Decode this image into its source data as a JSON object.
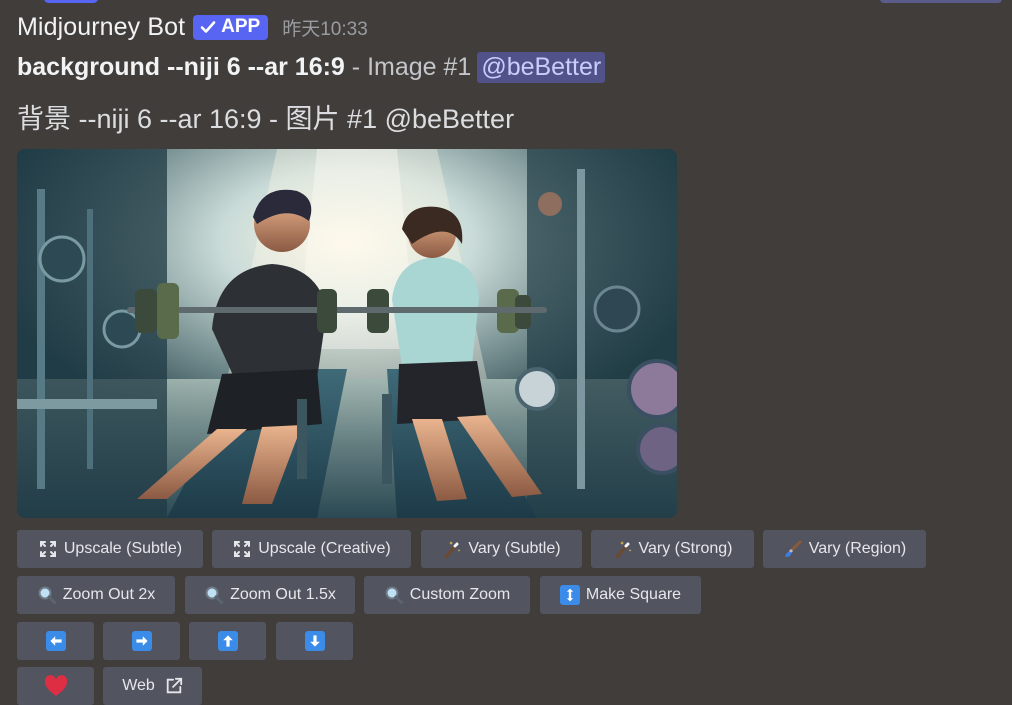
{
  "message": {
    "username": "Midjourney Bot",
    "badge": "APP",
    "timestamp": "昨天10:33",
    "prompt_bold": "background --niji 6 --ar 16:9",
    "separator": " - ",
    "image_label": "Image #1",
    "mention": "@beBetter",
    "translated_line": "背景 --niji 6 --ar 16:9 - 图片 #1 @beBetter"
  },
  "image": {
    "icon": "generated-anime-gym-image"
  },
  "buttons": {
    "row1": [
      {
        "label": "Upscale (Subtle)",
        "icon": "expand-arrows-icon"
      },
      {
        "label": "Upscale (Creative)",
        "icon": "expand-arrows-icon"
      },
      {
        "label": "Vary (Subtle)",
        "icon": "magic-wand-icon"
      },
      {
        "label": "Vary (Strong)",
        "icon": "magic-wand-icon"
      },
      {
        "label": "Vary (Region)",
        "icon": "paintbrush-icon"
      }
    ],
    "row2": [
      {
        "label": "Zoom Out 2x",
        "icon": "magnifier-icon"
      },
      {
        "label": "Zoom Out 1.5x",
        "icon": "magnifier-icon"
      },
      {
        "label": "Custom Zoom",
        "icon": "magnifier-icon"
      },
      {
        "label": "Make Square",
        "icon": "up-down-arrow-icon"
      }
    ],
    "row3": [
      {
        "label": "",
        "icon": "arrow-left-icon"
      },
      {
        "label": "",
        "icon": "arrow-right-icon"
      },
      {
        "label": "",
        "icon": "arrow-up-icon"
      },
      {
        "label": "",
        "icon": "arrow-down-icon"
      }
    ],
    "row4": [
      {
        "label": "",
        "icon": "heart-icon"
      },
      {
        "label": "Web",
        "icon": "external-link-icon"
      }
    ]
  },
  "colors": {
    "background": "#403d3a",
    "button": "#525460",
    "accent": "#5865f2",
    "mention_bg": "#51528a",
    "arrow_blue": "#3b8be8",
    "heart": "#dd2e44"
  }
}
